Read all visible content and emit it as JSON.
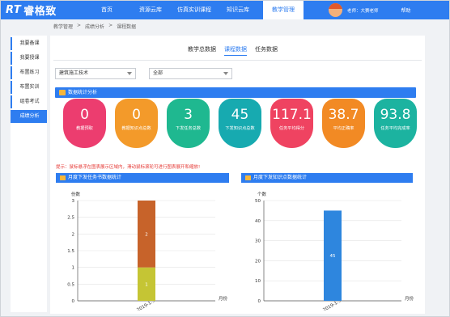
{
  "header": {
    "logo_rt": "RT",
    "logo_text": "睿格致",
    "nav": [
      {
        "label": "首页"
      },
      {
        "label": "资源云库"
      },
      {
        "label": "仿真实训课程"
      },
      {
        "label": "知识云库"
      },
      {
        "label": "教学管理"
      }
    ],
    "user": "老师：大赛老师",
    "help": "帮助"
  },
  "breadcrumb": [
    "教学管理",
    ">",
    "成绩分析",
    ">",
    "课程数据"
  ],
  "sidebar": [
    {
      "label": "我要备课"
    },
    {
      "label": "我要授课"
    },
    {
      "label": "布置练习"
    },
    {
      "label": "布置实训"
    },
    {
      "label": "组卷考试"
    },
    {
      "label": "成绩分析"
    }
  ],
  "tabs": [
    {
      "label": "教学总数据"
    },
    {
      "label": "课程数据"
    },
    {
      "label": "任务数据"
    }
  ],
  "filters": {
    "course": "建筑施工技术",
    "range": "全部"
  },
  "stats_title": "数据统计分析",
  "stats": [
    {
      "value": "0",
      "label": "教据预取",
      "color": "#ec3d6f"
    },
    {
      "value": "0",
      "label": "教据知识点总数",
      "color": "#f39a2a"
    },
    {
      "value": "3",
      "label": "下发任务总数",
      "color": "#1fb890"
    },
    {
      "value": "45",
      "label": "下发知识点总数",
      "color": "#17aab0"
    },
    {
      "value": "117.1",
      "label": "任务平均得分",
      "color": "#ef4361"
    },
    {
      "value": "38.7",
      "label": "平均正确率",
      "color": "#f28a24"
    },
    {
      "value": "93.8",
      "label": "任务平均完成率",
      "color": "#1cb3a0"
    }
  ],
  "tip": "提示：鼠标悬浮在图表展示区域内，滑动鼠标滚轮可进行图表展开和缩放!",
  "chart_data": [
    {
      "type": "bar",
      "title": "月度下发任务书数据统计",
      "ylabel": "份数",
      "xlabel": "月份",
      "categories": [
        "2019-1..."
      ],
      "series": [
        {
          "values": [
            1
          ],
          "color": "#c5c534"
        },
        {
          "values": [
            2
          ],
          "color": "#c7632a"
        }
      ],
      "ylim": [
        0,
        3
      ],
      "yticks": [
        "0",
        "0.5",
        "1",
        "1.5",
        "2",
        "2.5",
        "3"
      ],
      "stacked": true
    },
    {
      "type": "bar",
      "title": "月度下发知识点数据统计",
      "ylabel": "个数",
      "xlabel": "月份",
      "categories": [
        "2019-1..."
      ],
      "series": [
        {
          "values": [
            45
          ],
          "color": "#2e86de"
        }
      ],
      "ylim": [
        0,
        50
      ],
      "yticks": [
        "0",
        "10",
        "20",
        "30",
        "40",
        "50"
      ]
    }
  ]
}
